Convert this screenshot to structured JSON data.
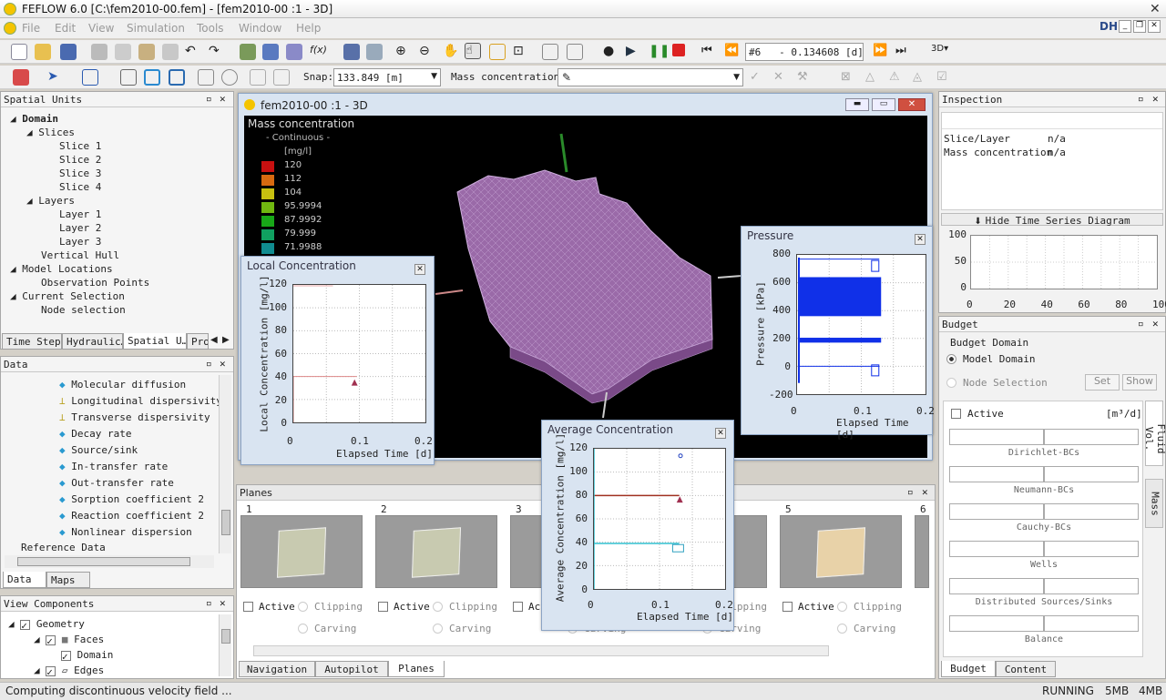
{
  "app": {
    "title": "FEFLOW 6.0 [C:\\fem2010-00.fem] - [fem2010-00 :1 - 3D]",
    "logo": "DHI"
  },
  "menu": [
    "File",
    "Edit",
    "View",
    "Simulation",
    "Tools",
    "Window",
    "Help"
  ],
  "toolbar": {
    "timestep": "#6   - 0.134608 [d]",
    "snap_label": "Snap:",
    "snap_value": "133.849 [m]",
    "mass_label": "Mass concentration:"
  },
  "spatial_units": {
    "title": "Spatial Units",
    "items": [
      "Domain",
      "Slices",
      "Slice 1",
      "Slice 2",
      "Slice 3",
      "Slice 4",
      "Layers",
      "Layer 1",
      "Layer 2",
      "Layer 3",
      "Vertical Hull",
      "Model Locations",
      "Observation Points",
      "Current Selection",
      "Node selection"
    ],
    "tabs": [
      "Time Steps",
      "Hydraulic…",
      "Spatial U…",
      "Pro"
    ]
  },
  "data_panel": {
    "title": "Data",
    "items": [
      "Molecular diffusion",
      "Longitudinal dispersivity",
      "Transverse dispersivity",
      "Decay rate",
      "Source/sink",
      "In-transfer rate",
      "Out-transfer rate",
      "Sorption coefficient 2",
      "Reaction coefficient 2",
      "Nonlinear dispersion"
    ],
    "ref": "Reference Data",
    "tabs": [
      "Data",
      "Maps"
    ]
  },
  "view_components": {
    "title": "View Components",
    "items": [
      "Geometry",
      "Faces",
      "Domain",
      "Edges"
    ]
  },
  "view3d": {
    "title": "fem2010-00 :1 - 3D",
    "legend_title": "Mass concentration",
    "legend_sub": "- Continuous -",
    "legend_unit": "[mg/l]",
    "legend": [
      {
        "v": "120",
        "c": "#c81010"
      },
      {
        "v": "112",
        "c": "#d86a10"
      },
      {
        "v": "104",
        "c": "#c8c010"
      },
      {
        "v": "95.9994",
        "c": "#70b810"
      },
      {
        "v": "87.9992",
        "c": "#18a818"
      },
      {
        "v": "79.999",
        "c": "#10a060"
      },
      {
        "v": "71.9988",
        "c": "#108c90"
      }
    ]
  },
  "local_conc": {
    "title": "Local Concentration",
    "ylabel": "Local Concentration [mg/l]",
    "xlabel": "Elapsed Time [d]",
    "yticks": [
      "120",
      "100",
      "80",
      "60",
      "40",
      "20",
      "0"
    ],
    "xticks": [
      "0",
      "0.1",
      "0.2"
    ]
  },
  "avg_conc": {
    "title": "Average Concentration",
    "ylabel": "Average Concentration [mg/l]",
    "xlabel": "Elapsed Time [d]",
    "yticks": [
      "120",
      "100",
      "80",
      "60",
      "40",
      "20",
      "0"
    ],
    "xticks": [
      "0",
      "0.1",
      "0.2"
    ]
  },
  "pressure": {
    "title": "Pressure",
    "ylabel": "Pressure [kPa]",
    "xlabel": "Elapsed Time [d]",
    "yticks": [
      "800",
      "600",
      "400",
      "200",
      "0",
      "-200"
    ],
    "xticks": [
      "0",
      "0.1",
      "0.2"
    ]
  },
  "inspection": {
    "title": "Inspection",
    "rows": [
      [
        "Slice/Layer",
        "n/a"
      ],
      [
        "Mass concentration",
        "n/a"
      ]
    ],
    "hide_btn": "Hide Time Series Diagram",
    "yticks": [
      "100",
      "50",
      "0"
    ],
    "xticks": [
      "0",
      "20",
      "40",
      "60",
      "80",
      "100"
    ]
  },
  "budget": {
    "title": "Budget",
    "group": "Budget Domain",
    "opt1": "Model Domain",
    "opt2": "Node Selection",
    "set": "Set",
    "show": "Show",
    "active": "Active",
    "unit": "[m³/d]",
    "labels": [
      "Dirichlet-BCs",
      "Neumann-BCs",
      "Cauchy-BCs",
      "Wells",
      "Distributed Sources/Sinks",
      "Balance"
    ],
    "side_tabs": [
      "Fluid Vol.",
      "Mass"
    ],
    "tabs": [
      "Budget",
      "Content"
    ]
  },
  "planes": {
    "title": "Planes",
    "numbers": [
      "1",
      "2",
      "3",
      "4",
      "5",
      "6"
    ],
    "active": "Active",
    "clipping": "Clipping",
    "carving": "Carving",
    "tabs": [
      "Navigation",
      "Autopilot",
      "Planes"
    ]
  },
  "status": {
    "left": "Computing discontinuous velocity field ...",
    "state": "RUNNING",
    "mem1": "5MB",
    "mem2": "4MB"
  }
}
